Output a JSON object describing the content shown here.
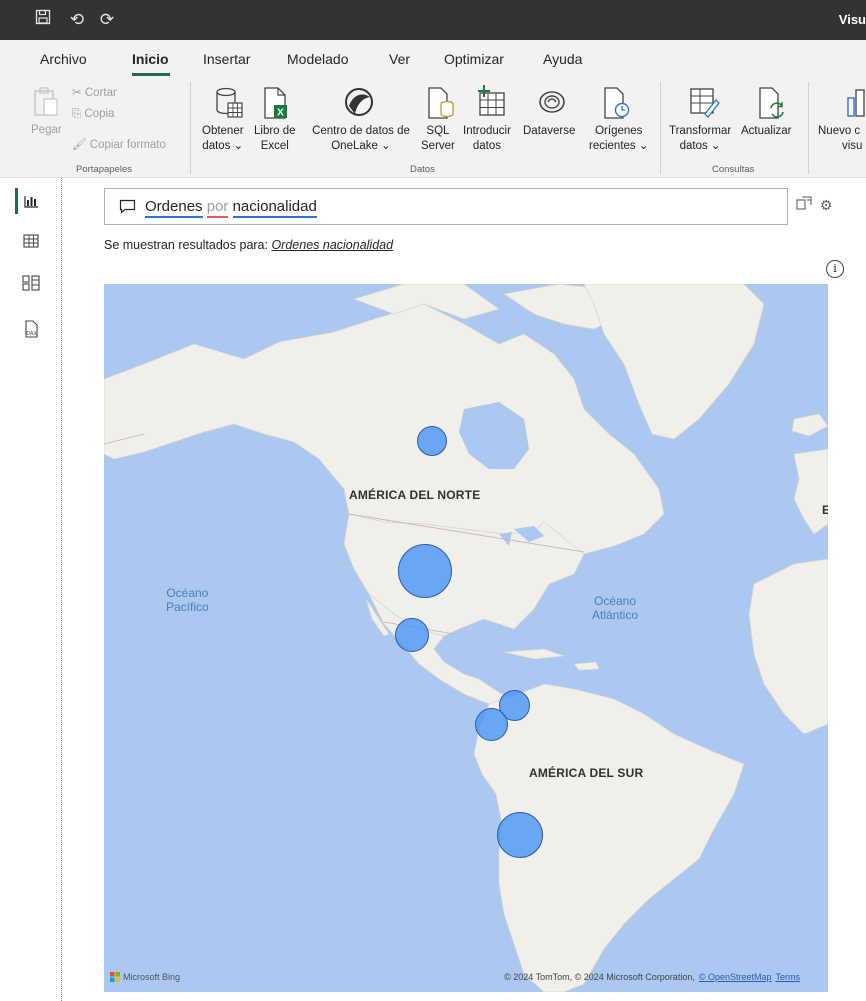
{
  "titlebar": {
    "app_fragment": "Visu"
  },
  "menu": {
    "tabs": [
      "Archivo",
      "Inicio",
      "Insertar",
      "Modelado",
      "Ver",
      "Optimizar",
      "Ayuda"
    ],
    "active": "Inicio"
  },
  "ribbon": {
    "clipboard": {
      "paste": "Pegar",
      "cut": "Cortar",
      "copy": "Copia",
      "copy_format": "Copiar formato",
      "group": "Portapapeles"
    },
    "data": {
      "get_data": [
        "Obtener",
        "datos ⌄"
      ],
      "excel": [
        "Libro de",
        "Excel"
      ],
      "onelake": [
        "Centro de datos de",
        "OneLake ⌄"
      ],
      "sql": [
        "SQL",
        "Server"
      ],
      "enter": [
        "Introducir",
        "datos"
      ],
      "dataverse": "Dataverse",
      "recent": [
        "Orígenes",
        "recientes ⌄"
      ],
      "group": "Datos"
    },
    "queries": {
      "transform": [
        "Transformar",
        "datos ⌄"
      ],
      "refresh": "Actualizar",
      "group": "Consultas"
    },
    "new_visual": [
      "Nuevo c",
      "visu"
    ]
  },
  "qa": {
    "query_word1": "Ordenes",
    "query_word2": "por",
    "query_word3": "nacionalidad",
    "results_prefix": "Se muestran resultados para: ",
    "results_link": "Ordenes nacionalidad"
  },
  "map": {
    "labels": {
      "north_america": "AMÉRICA DEL NORTE",
      "south_america": "AMÉRICA DEL SUR",
      "europe_fragment": "E"
    },
    "oceans": {
      "pacific": [
        "Océano",
        "Pacífico"
      ],
      "atlantic": [
        "Océano",
        "Atlántico"
      ]
    },
    "attribution": "© 2024 TomTom, © 2024 Microsoft Corporation,",
    "osm": "© OpenStreetMap",
    "terms": "Terms",
    "bing": "Microsoft Bing",
    "bubbles": [
      {
        "name": "canada",
        "size": "small"
      },
      {
        "name": "united-states",
        "size": "large"
      },
      {
        "name": "mexico",
        "size": "medium"
      },
      {
        "name": "colombia",
        "size": "medium"
      },
      {
        "name": "ecuador",
        "size": "medium"
      },
      {
        "name": "chile",
        "size": "large"
      }
    ]
  },
  "colors": {
    "accent": "#1f6b46",
    "bubble": "#4b96f5",
    "water": "#aac8f0",
    "land": "#f0efe9"
  }
}
